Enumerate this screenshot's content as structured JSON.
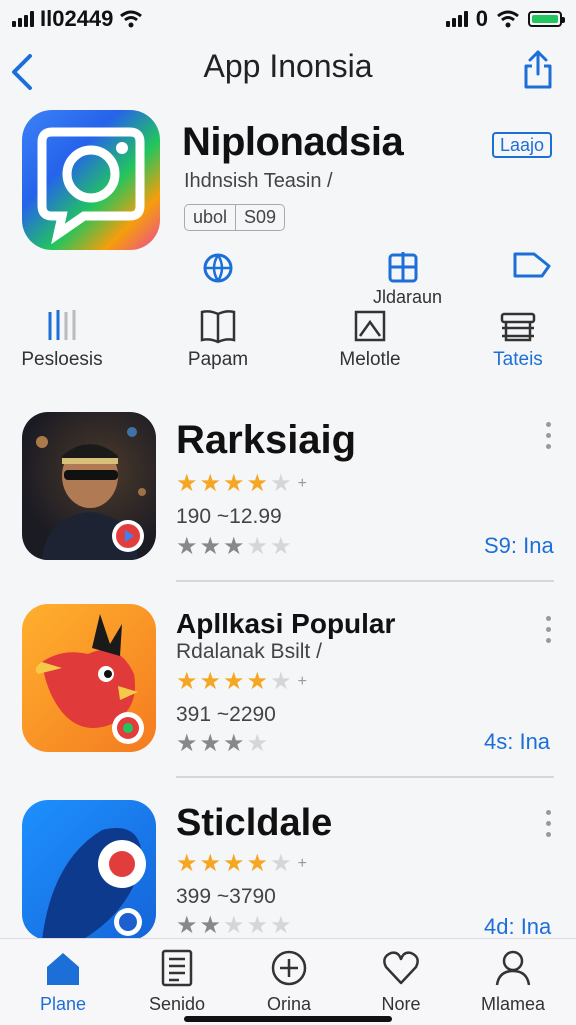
{
  "status": {
    "left_text": "Il02449",
    "right_text": "0"
  },
  "nav": {
    "title": "App Inonsia"
  },
  "hero": {
    "title": "Niplonadsia",
    "subtitle": "Ihdnsish Teasin /",
    "chips": [
      "ubol",
      "S09"
    ],
    "lang_button": "Laajo"
  },
  "actions": [
    {
      "icon": "globe-icon",
      "label": ""
    },
    {
      "icon": "plus-box-icon",
      "label": "Jldaraun"
    },
    {
      "icon": "tag-icon",
      "label": ""
    }
  ],
  "tabs": [
    {
      "icon": "bars-icon",
      "label": "Pesloesis"
    },
    {
      "icon": "book-icon",
      "label": "Papam"
    },
    {
      "icon": "image-icon",
      "label": "Melotle"
    },
    {
      "icon": "stack-icon",
      "label": "Tateis",
      "active": true
    }
  ],
  "apps": [
    {
      "title": "Rarksiaig",
      "subtitle": "",
      "rating_main": "3.5",
      "rating_suffix": "+",
      "range": "190 ~12.99",
      "size": "S9: Ina",
      "icon": "person-icon"
    },
    {
      "title": "Apllkasi Popular",
      "subtitle": "Rdalanak Bsilt /",
      "rating_main": "3.5",
      "rating_suffix": "+",
      "range": "391 ~2290",
      "size": "4s: Ina",
      "icon": "bird-icon"
    },
    {
      "title": "Sticldale",
      "subtitle": "",
      "rating_main": "3.5",
      "rating_suffix": "+",
      "range": "399 ~3790",
      "size": "4d: Ina",
      "icon": "pin-icon"
    }
  ],
  "tabbar": [
    {
      "icon": "home-icon",
      "label": "Plane",
      "active": true
    },
    {
      "icon": "list-icon",
      "label": "Senido"
    },
    {
      "icon": "plus-circle-icon",
      "label": "Orina"
    },
    {
      "icon": "heart-icon",
      "label": "Nore"
    },
    {
      "icon": "person-icon",
      "label": "Mlamea"
    }
  ],
  "colors": {
    "accent": "#1d6fd8",
    "star": "#f5a623",
    "bg": "#f5f6f8"
  }
}
